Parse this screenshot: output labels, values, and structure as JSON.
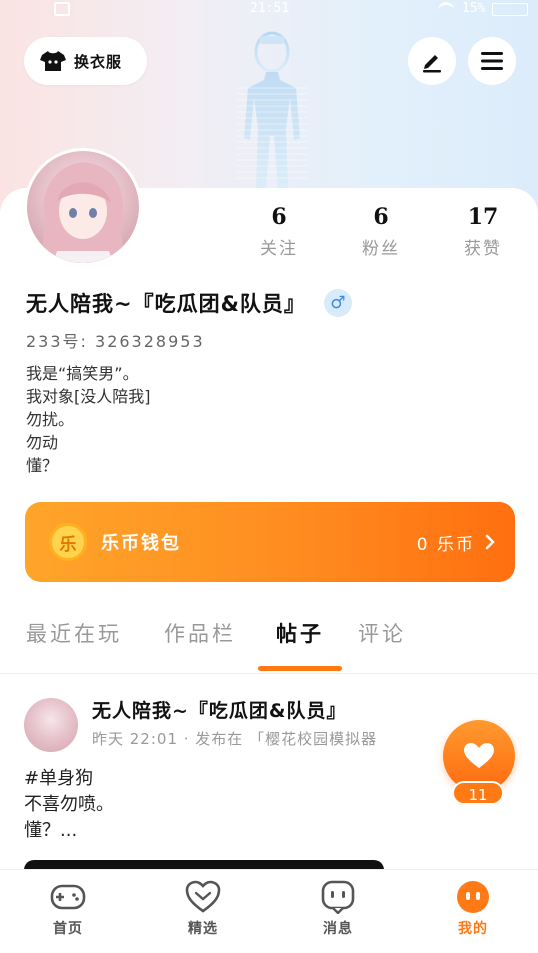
{
  "status_bar": {
    "time": "21:51",
    "battery_pct": "15%"
  },
  "header": {
    "outfit_label": "换衣服"
  },
  "profile": {
    "stats": [
      {
        "value": "6",
        "label": "关注"
      },
      {
        "value": "6",
        "label": "粉丝"
      },
      {
        "value": "17",
        "label": "获赞"
      }
    ],
    "username": "无人陪我~『吃瓜团&队员』",
    "gender_symbol": "♂",
    "uid": "233号: 326328953",
    "bio": [
      "我是“搞笑男”。",
      "我对象[没人陪我]",
      "勿扰。",
      "勿动",
      "懂？"
    ]
  },
  "wallet": {
    "coin_char": "乐",
    "title": "乐币钱包",
    "balance": "0 乐币"
  },
  "tabs": {
    "items": [
      "最近在玩",
      "作品栏",
      "帖子",
      "评论"
    ],
    "active_index": 2
  },
  "post": {
    "author": "无人陪我~『吃瓜团&队员』",
    "meta": "昨天 22:01 · 发布在 「樱花校园模拟器",
    "body": [
      "#单身狗",
      "不喜勿喷。",
      "懂？..."
    ],
    "like_count": "11"
  },
  "bottom_nav": {
    "items": [
      "首页",
      "精选",
      "消息",
      "我的"
    ],
    "active_index": 3
  },
  "colors": {
    "accent": "#ff7a14",
    "wallet_start": "#ffa52a",
    "wallet_end": "#ff6f10",
    "gender_bg": "#d8ebfb"
  }
}
